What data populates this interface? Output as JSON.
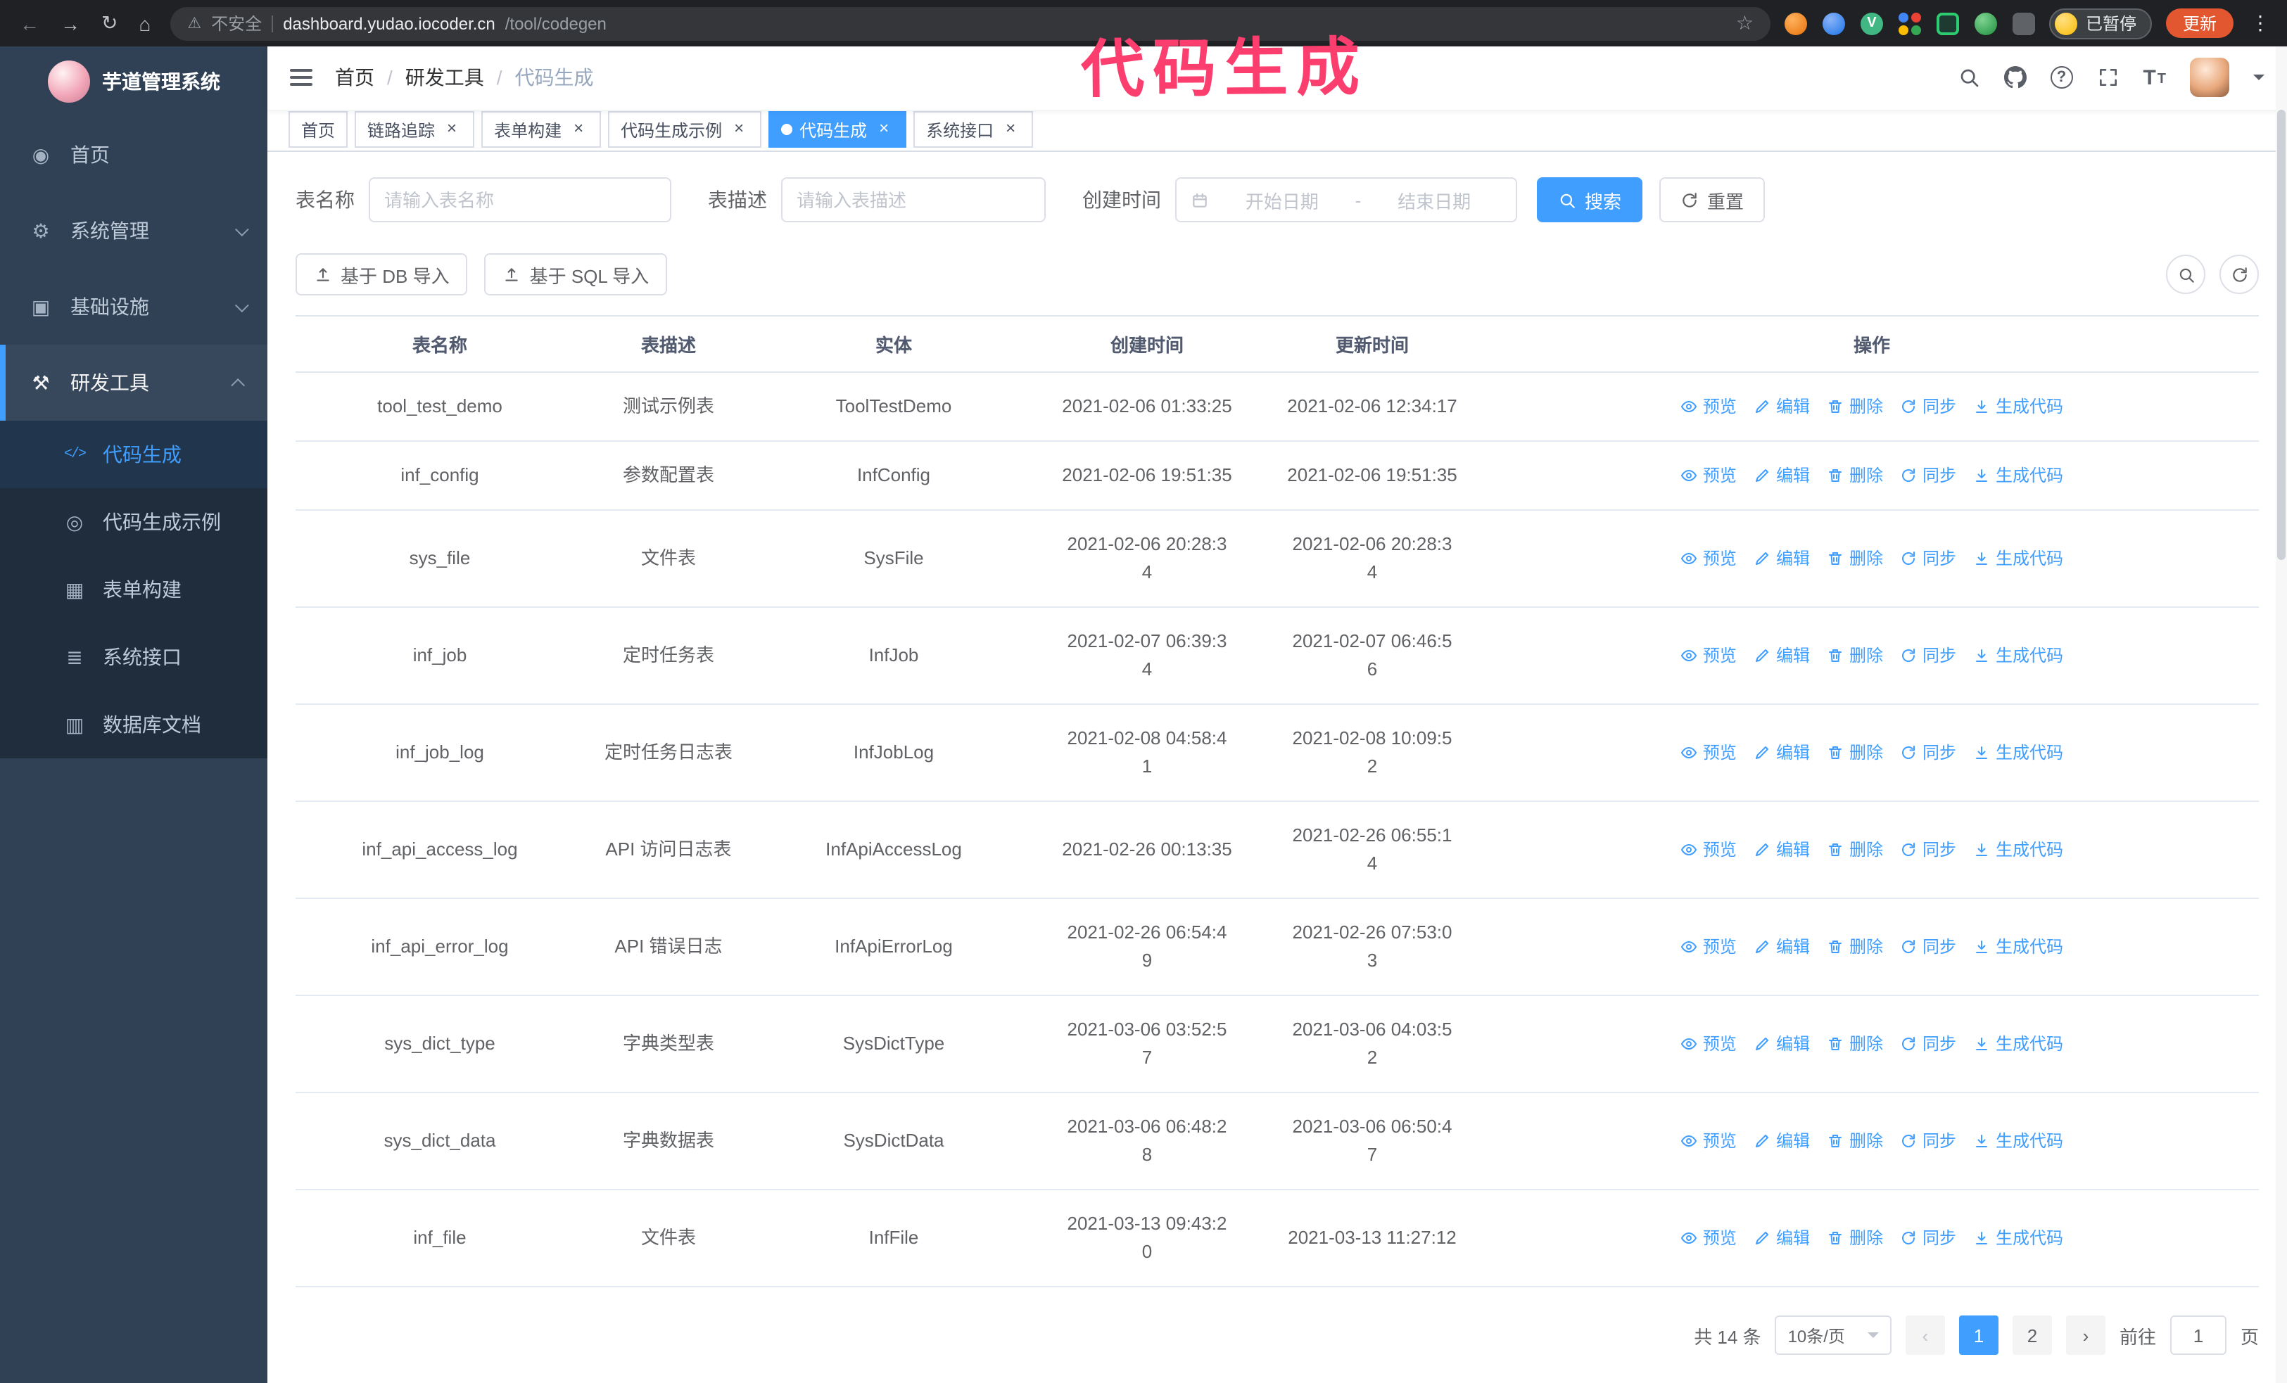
{
  "browser": {
    "security_label": "不安全",
    "url_host": "dashboard.yudao.iocoder.cn",
    "url_path": "/tool/codegen",
    "profile_label": "已暂停",
    "update_label": "更新"
  },
  "icons": {
    "back": "←",
    "forward": "→",
    "reload": "↻",
    "home": "⌂",
    "warning": "⚠",
    "star": "☆",
    "kebab": "⋮",
    "dashboard": "◉",
    "gear": "⚙",
    "monitor": "▣",
    "tools": "⚒",
    "code": "</>",
    "example": "◎",
    "form": "▦",
    "api": "≣",
    "database": "▥",
    "close": "×",
    "help": "?",
    "font_size": "T",
    "prev": "‹",
    "next": "›",
    "vue_v": "V"
  },
  "annotation": {
    "text": "代码生成",
    "color": "#fb3e6e"
  },
  "sidebar": {
    "logo_title": "芋道管理系统",
    "items": [
      {
        "label": "首页"
      },
      {
        "label": "系统管理"
      },
      {
        "label": "基础设施"
      },
      {
        "label": "研发工具"
      }
    ],
    "sub_items": [
      {
        "label": "代码生成",
        "active": true
      },
      {
        "label": "代码生成示例"
      },
      {
        "label": "表单构建"
      },
      {
        "label": "系统接口"
      },
      {
        "label": "数据库文档"
      }
    ]
  },
  "header": {
    "breadcrumb": [
      "首页",
      "研发工具",
      "代码生成"
    ],
    "breadcrumb_separator": "/"
  },
  "tabs": [
    {
      "label": "首页",
      "closable": false
    },
    {
      "label": "链路追踪",
      "closable": true
    },
    {
      "label": "表单构建",
      "closable": true
    },
    {
      "label": "代码生成示例",
      "closable": true
    },
    {
      "label": "代码生成",
      "closable": true,
      "active": true
    },
    {
      "label": "系统接口",
      "closable": true
    }
  ],
  "filters": {
    "table_name_label": "表名称",
    "table_name_placeholder": "请输入表名称",
    "table_desc_label": "表描述",
    "table_desc_placeholder": "请输入表描述",
    "create_time_label": "创建时间",
    "date_start_placeholder": "开始日期",
    "date_separator": "-",
    "date_end_placeholder": "结束日期",
    "search_label": "搜索",
    "reset_label": "重置"
  },
  "toolbar": {
    "import_db_label": "基于 DB 导入",
    "import_sql_label": "基于 SQL 导入"
  },
  "table": {
    "columns": [
      "表名称",
      "表描述",
      "实体",
      "创建时间",
      "更新时间",
      "操作"
    ],
    "actions": [
      "预览",
      "编辑",
      "删除",
      "同步",
      "生成代码"
    ],
    "rows": [
      {
        "name": "tool_test_demo",
        "desc": "测试示例表",
        "entity": "ToolTestDemo",
        "created": "2021-02-06 01:33:25",
        "updated": "2021-02-06 12:34:17"
      },
      {
        "name": "inf_config",
        "desc": "参数配置表",
        "entity": "InfConfig",
        "created": "2021-02-06 19:51:35",
        "updated": "2021-02-06 19:51:35"
      },
      {
        "name": "sys_file",
        "desc": "文件表",
        "entity": "SysFile",
        "created": "2021-02-06 20:28:3\n4",
        "updated": "2021-02-06 20:28:3\n4"
      },
      {
        "name": "inf_job",
        "desc": "定时任务表",
        "entity": "InfJob",
        "created": "2021-02-07 06:39:3\n4",
        "updated": "2021-02-07 06:46:5\n6"
      },
      {
        "name": "inf_job_log",
        "desc": "定时任务日志表",
        "entity": "InfJobLog",
        "created": "2021-02-08 04:58:4\n1",
        "updated": "2021-02-08 10:09:5\n2"
      },
      {
        "name": "inf_api_access_log",
        "desc": "API 访问日志表",
        "entity": "InfApiAccessLog",
        "created": "2021-02-26 00:13:35",
        "updated": "2021-02-26 06:55:1\n4"
      },
      {
        "name": "inf_api_error_log",
        "desc": "API 错误日志",
        "entity": "InfApiErrorLog",
        "created": "2021-02-26 06:54:4\n9",
        "updated": "2021-02-26 07:53:0\n3"
      },
      {
        "name": "sys_dict_type",
        "desc": "字典类型表",
        "entity": "SysDictType",
        "created": "2021-03-06 03:52:5\n7",
        "updated": "2021-03-06 04:03:5\n2"
      },
      {
        "name": "sys_dict_data",
        "desc": "字典数据表",
        "entity": "SysDictData",
        "created": "2021-03-06 06:48:2\n8",
        "updated": "2021-03-06 06:50:4\n7"
      },
      {
        "name": "inf_file",
        "desc": "文件表",
        "entity": "InfFile",
        "created": "2021-03-13 09:43:2\n0",
        "updated": "2021-03-13 11:27:12"
      }
    ]
  },
  "pagination": {
    "total_label": "共 14 条",
    "page_size_label": "10条/页",
    "pages": [
      "1",
      "2"
    ],
    "active_page": "1",
    "goto_label": "前往",
    "goto_value": "1",
    "page_unit": "页"
  },
  "theme": {
    "accent": "#409eff",
    "sidebar_bg": "#304156",
    "submenu_bg": "#1f2d3d"
  }
}
